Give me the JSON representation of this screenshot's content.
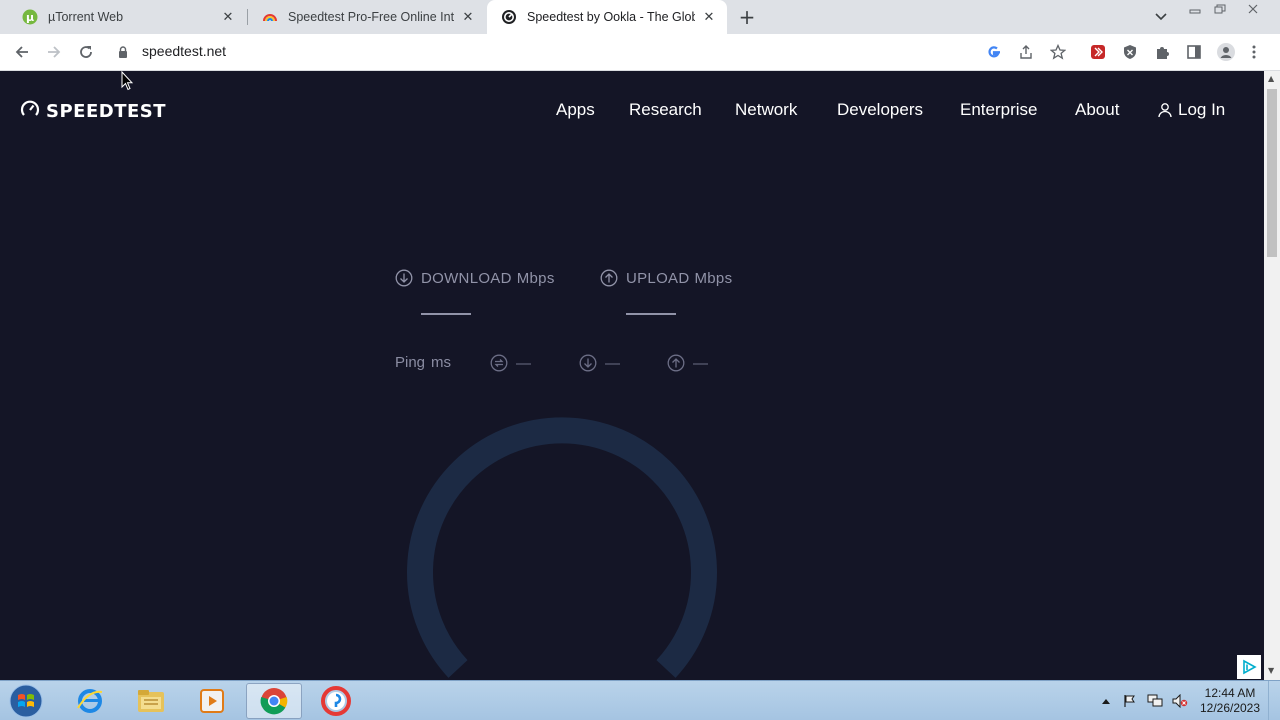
{
  "browser": {
    "tabs": [
      {
        "title": "µTorrent Web",
        "favicon": "utorrent-icon",
        "active": false
      },
      {
        "title": "Speedtest Pro-Free Online Internet Speed Test",
        "favicon": "rainbow-gauge-icon",
        "active": false
      },
      {
        "title": "Speedtest by Ookla - The Global Broadband Speed Test",
        "favicon": "ookla-icon",
        "active": true
      }
    ],
    "url": "speedtest.net"
  },
  "site": {
    "logo_text": "SPEEDTEST",
    "nav": [
      "Apps",
      "Research",
      "Network",
      "Developers",
      "Enterprise",
      "About"
    ],
    "login_label": "Log In"
  },
  "test": {
    "download_label": "DOWNLOAD",
    "upload_label": "UPLOAD",
    "unit": "Mbps",
    "ping_label": "Ping",
    "ping_unit": "ms",
    "jitter_value": "—",
    "latency_down_value": "—",
    "latency_up_value": "—"
  },
  "taskbar": {
    "time": "12:44 AM",
    "date": "12/26/2023"
  },
  "colors": {
    "page_bg": "#141526",
    "gauge_ring": "#1c2a44",
    "muted_text": "#9193a8"
  }
}
